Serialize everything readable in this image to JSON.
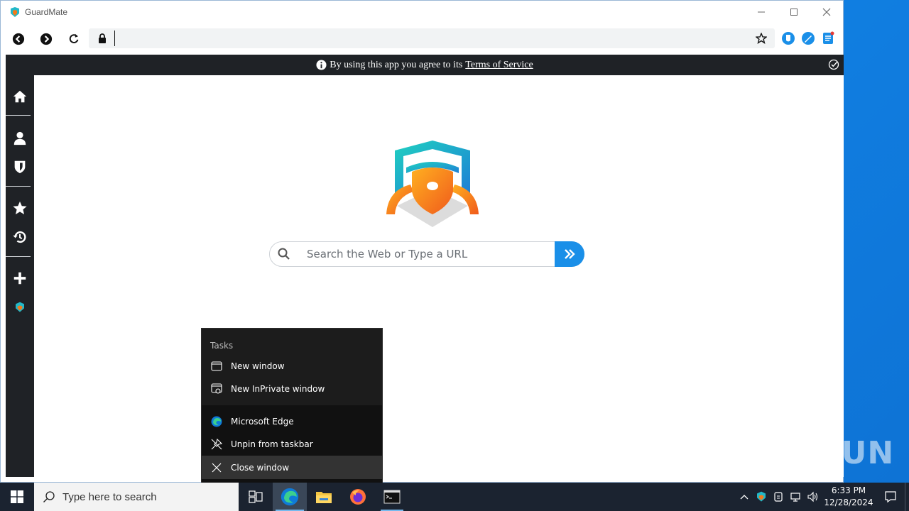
{
  "window": {
    "title": "GuardMate",
    "controls": {
      "minimize": "—",
      "maximize": "☐",
      "close": "✕"
    }
  },
  "navbar": {
    "back_icon": "back-icon",
    "forward_icon": "forward-icon",
    "reload_icon": "reload-icon",
    "url_value": "",
    "extensions": [
      "shield-extension-icon",
      "paint-extension-icon",
      "notes-extension-icon"
    ]
  },
  "tos_bar": {
    "prefix": "By using this app you agree to its",
    "link": "Terms of Service"
  },
  "sidebar": {
    "items": [
      "home-icon",
      "profile-icon",
      "shield-icon",
      "favorites-icon",
      "history-icon",
      "add-icon",
      "guardmate-icon"
    ]
  },
  "search": {
    "placeholder": "Search the Web or Type a URL"
  },
  "jumplist": {
    "header": "Tasks",
    "tasks": [
      {
        "label": "New window",
        "icon": "window-icon"
      },
      {
        "label": "New InPrivate window",
        "icon": "inprivate-icon"
      }
    ],
    "actions": [
      {
        "label": "Microsoft Edge",
        "icon": "edge-icon"
      },
      {
        "label": "Unpin from taskbar",
        "icon": "unpin-icon"
      },
      {
        "label": "Close window",
        "icon": "close-icon"
      }
    ]
  },
  "taskbar": {
    "search_placeholder": "Type here to search",
    "apps": [
      "task-view-icon",
      "edge-icon",
      "file-explorer-icon",
      "firefox-icon",
      "terminal-icon"
    ],
    "time": "6:33 PM",
    "date": "12/28/2024"
  },
  "watermark": "ANY RUN",
  "colors": {
    "accent": "#1a8fe8",
    "dark_bar": "#1f2226",
    "taskbar": "#1b2330"
  }
}
